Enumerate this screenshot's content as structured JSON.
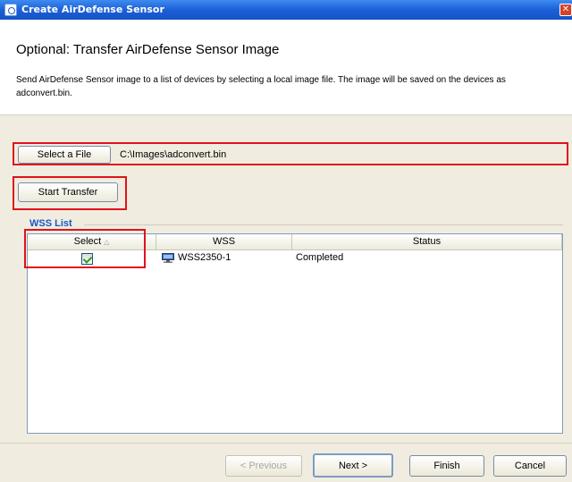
{
  "window": {
    "title": "Create AirDefense Sensor"
  },
  "header": {
    "heading": "Optional: Transfer AirDefense Sensor Image",
    "description": "Send AirDefense Sensor image to a list of devices by selecting a local image file. The image will be saved on the devices as adconvert.bin."
  },
  "file": {
    "select_label": "Select a File",
    "path": "C:\\Images\\adconvert.bin"
  },
  "transfer": {
    "start_label": "Start Transfer"
  },
  "wss_list": {
    "legend": "WSS List",
    "columns": [
      "Select",
      "WSS",
      "Status"
    ],
    "rows": [
      {
        "selected": true,
        "wss": "WSS2350-1",
        "status": "Completed"
      }
    ]
  },
  "footer": {
    "previous_label": "< Previous",
    "next_label": "Next >",
    "finish_label": "Finish",
    "cancel_label": "Cancel"
  },
  "colors": {
    "titlebar": "#1c5fd6",
    "highlight": "#e0121d",
    "legend": "#1a57c8",
    "panel": "#f0ede0"
  }
}
